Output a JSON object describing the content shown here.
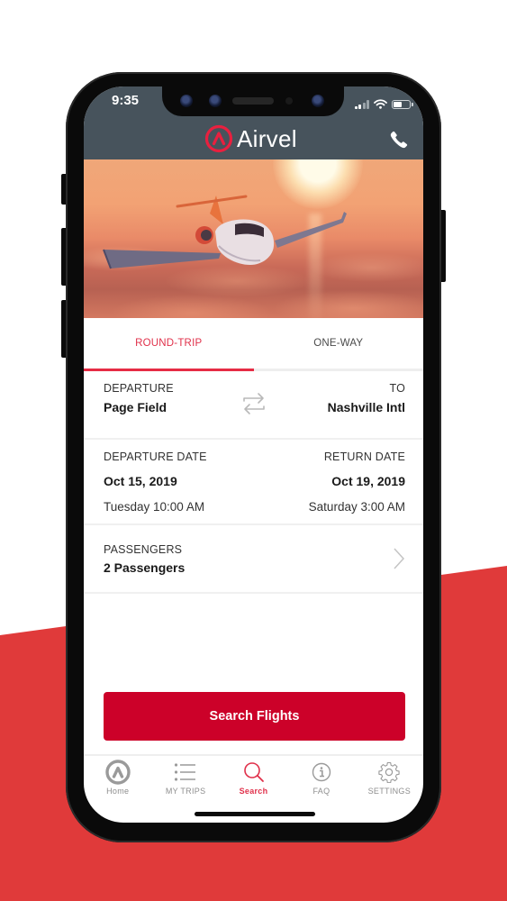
{
  "status_bar": {
    "time": "9:35"
  },
  "header": {
    "brand": "Airvel",
    "call_icon": "phone-icon"
  },
  "colors": {
    "accent": "#e0304a",
    "button": "#cc0129",
    "header_bg": "#47535c",
    "backdrop_red": "#e03a3a"
  },
  "trip_tabs": [
    {
      "label": "ROUND-TRIP",
      "active": true
    },
    {
      "label": "ONE-WAY",
      "active": false
    }
  ],
  "route": {
    "from_label": "DEPARTURE",
    "from_value": "Page Field",
    "to_label": "TO",
    "to_value": "Nashville Intl",
    "swap_icon": "swap-arrows-icon"
  },
  "dates": {
    "departure_label": "DEPARTURE DATE",
    "departure_date": "Oct 15, 2019",
    "departure_time": "Tuesday 10:00 AM",
    "return_label": "RETURN DATE",
    "return_date": "Oct 19, 2019",
    "return_time": "Saturday 3:00 AM"
  },
  "passengers": {
    "label": "PASSENGERS",
    "value": "2 Passengers"
  },
  "search_button": {
    "label": "Search Flights"
  },
  "tab_bar": [
    {
      "label": "Home",
      "icon": "airvel-logo-icon",
      "active": false
    },
    {
      "label": "MY TRIPS",
      "icon": "list-icon",
      "active": false
    },
    {
      "label": "Search",
      "icon": "search-icon",
      "active": true
    },
    {
      "label": "FAQ",
      "icon": "info-icon",
      "active": false
    },
    {
      "label": "SETTINGS",
      "icon": "gear-icon",
      "active": false
    }
  ]
}
